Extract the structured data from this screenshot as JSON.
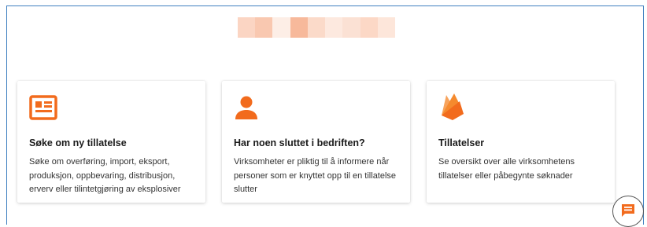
{
  "header": {
    "logo_blur_colors": [
      "#fbd5c3",
      "#f9c8b0",
      "#fdeee6",
      "#f7b99b",
      "#fbdac9",
      "#fde9df",
      "#fbe1d4",
      "#fcd8c6",
      "#fde6da"
    ]
  },
  "cards": [
    {
      "icon": "newspaper-icon",
      "title": "Søke om ny tillatelse",
      "description": "Søke om overføring, import, eksport, produksjon, oppbevaring, distribusjon, erverv eller tilintetgjøring av eksplosiver"
    },
    {
      "icon": "person-icon",
      "title": "Har noen sluttet i bedriften?",
      "description": "Virksomheter er pliktig til å informere når personer som er knyttet opp til en tillatelse slutter"
    },
    {
      "icon": "firebase-flame-icon",
      "title": "Tillatelser",
      "description": "Se oversikt over alle virksomhetens tillatelser eller påbegynte søknader"
    }
  ],
  "chat": {
    "icon": "chat-bubble-icon"
  },
  "colors": {
    "accent": "#f26b1d",
    "frame_border": "#3f7fc0"
  }
}
